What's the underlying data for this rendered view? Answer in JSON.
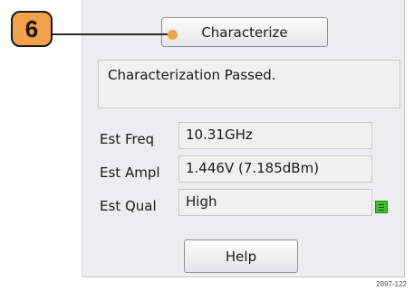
{
  "callout": {
    "number": "6"
  },
  "panel": {
    "characterize_button": "Characterize",
    "status_message": "Characterization Passed.",
    "fields": {
      "freq": {
        "label": "Est Freq",
        "value": "10.31GHz"
      },
      "ampl": {
        "label": "Est Ampl",
        "value": "1.446V (7.185dBm)"
      },
      "qual": {
        "label": "Est Qual",
        "value": "High"
      }
    },
    "quality_indicator_icon": "signal-quality-icon",
    "help_button": "Help"
  },
  "figure_id": "2897-122",
  "colors": {
    "callout": "#f2a24a",
    "quality_green": "#3fbf2c",
    "panel_bg": "#ecedee"
  }
}
